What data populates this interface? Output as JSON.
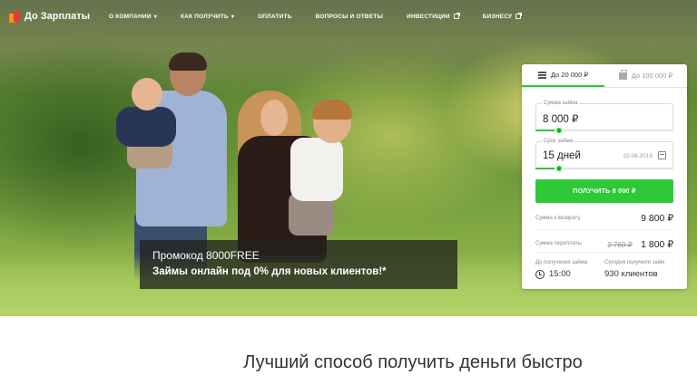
{
  "header": {
    "logo_text": "До Зарплаты",
    "nav": [
      {
        "label": "О компании",
        "has_dropdown": true,
        "external": false
      },
      {
        "label": "Как получить",
        "has_dropdown": true,
        "external": false
      },
      {
        "label": "Оплатить",
        "has_dropdown": false,
        "external": false
      },
      {
        "label": "Вопросы и ответы",
        "has_dropdown": false,
        "external": false
      },
      {
        "label": "Инвестиции",
        "has_dropdown": false,
        "external": true
      },
      {
        "label": "Бизнесу",
        "has_dropdown": false,
        "external": true
      }
    ]
  },
  "promo": {
    "code": "Промокод 8000FREE",
    "text": "Займы онлайн под 0% для новых клиентов!*"
  },
  "calculator": {
    "tabs": [
      {
        "label": "До 20 000 ₽",
        "icon": "stack-icon",
        "active": true
      },
      {
        "label": "До 100 000 ₽",
        "icon": "briefcase-icon",
        "active": false
      }
    ],
    "amount": {
      "label": "Сумма займа",
      "value": "8 000 ₽",
      "level": 0.17
    },
    "term": {
      "label": "Срок займа",
      "value": "15 дней",
      "date": "22.06.2019",
      "level": 0.17
    },
    "submit_label": "Получить 8 000 ₽",
    "repay": {
      "label": "Сумма к возврату",
      "value": "9 800 ₽"
    },
    "overpay": {
      "label": "Сумма переплаты",
      "old_value": "2 760 ₽",
      "value": "1 800 ₽"
    },
    "until_label": "До получения займа",
    "until_value": "15:00",
    "today_label": "Сегодня получили займ",
    "today_value": "930 клиентов"
  },
  "tagline": "Лучший способ получить деньги быстро",
  "colors": {
    "accent": "#2dc937",
    "logo_orange": "#f7941d",
    "logo_red": "#e53935"
  }
}
